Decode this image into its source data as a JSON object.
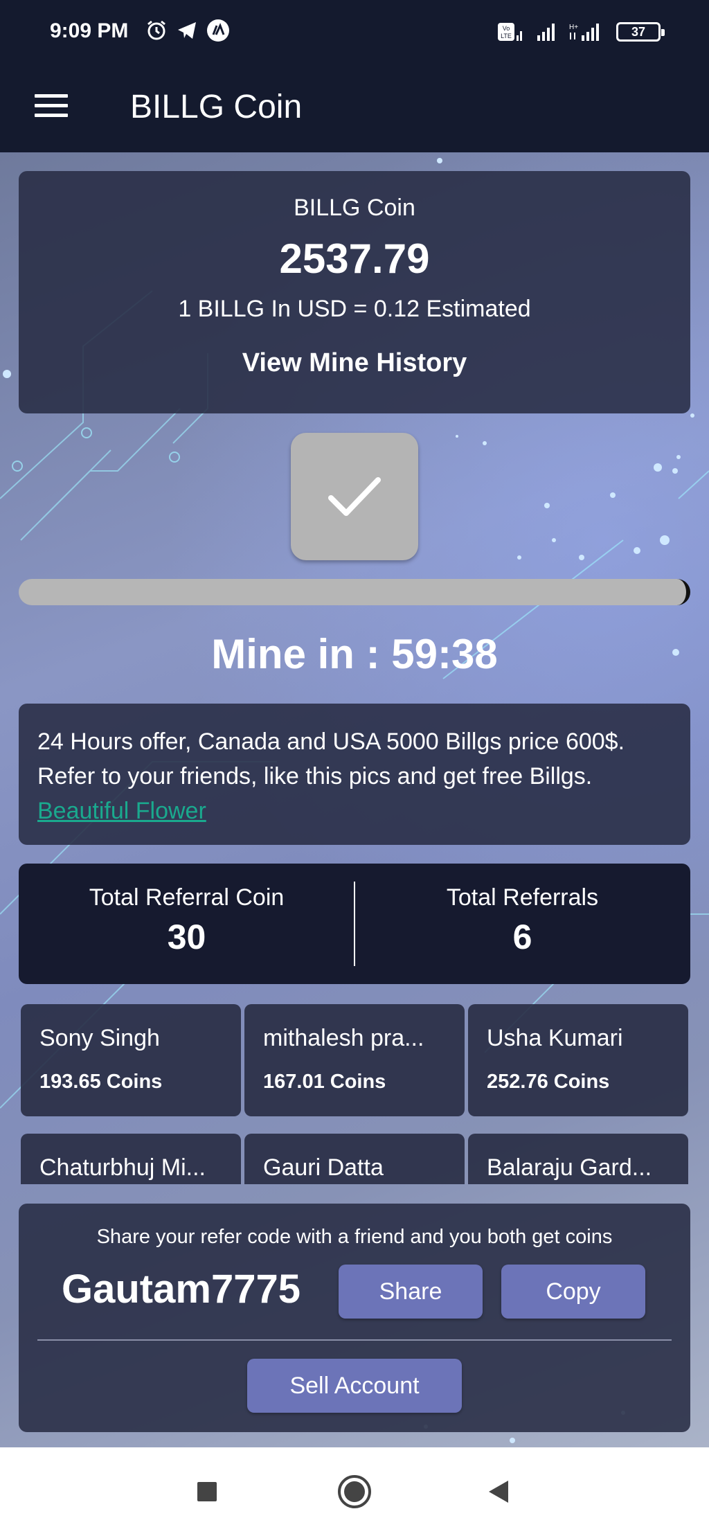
{
  "status_bar": {
    "time": "9:09 PM",
    "left_icons": [
      "alarm-icon",
      "telegram-icon",
      "app-notification-icon"
    ],
    "right_icons": [
      "volte-icon",
      "signal-icon",
      "hplus-signal-icon"
    ],
    "battery_level": "37"
  },
  "app_bar": {
    "menu_icon": "hamburger-menu-icon",
    "title": "BILLG Coin"
  },
  "balance": {
    "title": "BILLG Coin",
    "value": "2537.79",
    "usd_rate": "1 BILLG In USD = 0.12 Estimated",
    "history_label": "View Mine History"
  },
  "mine": {
    "button_icon": "checkmark-icon",
    "progress": 1.0,
    "timer_text": "Mine in : 59:38"
  },
  "offer": {
    "text": "24 Hours offer, Canada and USA 5000 Billgs price 600$. Refer to your friends, like this pics and get free Billgs. ",
    "link_text": "Beautiful Flower"
  },
  "referral_stats": {
    "coin_label": "Total Referral Coin",
    "coin_value": "30",
    "count_label": "Total Referrals",
    "count_value": "6"
  },
  "referrals": [
    {
      "name": "Sony Singh",
      "coins": "193.65 Coins"
    },
    {
      "name": "mithalesh pra...",
      "coins": "167.01 Coins"
    },
    {
      "name": "Usha Kumari",
      "coins": "252.76 Coins"
    },
    {
      "name": "Chaturbhuj Mi...",
      "coins": ""
    },
    {
      "name": "Gauri Datta",
      "coins": ""
    },
    {
      "name": "Balaraju Gard...",
      "coins": ""
    }
  ],
  "share": {
    "text": "Share your refer code with a friend and you both get coins",
    "code": "Gautam7775",
    "share_label": "Share",
    "copy_label": "Copy",
    "sell_label": "Sell Account"
  },
  "nav_bar": {
    "icons": [
      "recents-square-icon",
      "home-circle-icon",
      "back-triangle-icon"
    ]
  },
  "colors": {
    "app_bar": "#141a2e",
    "card": "#282c44",
    "button": "#6c74b8",
    "link": "#1aa98e",
    "mine_button": "#b4b4b4"
  }
}
